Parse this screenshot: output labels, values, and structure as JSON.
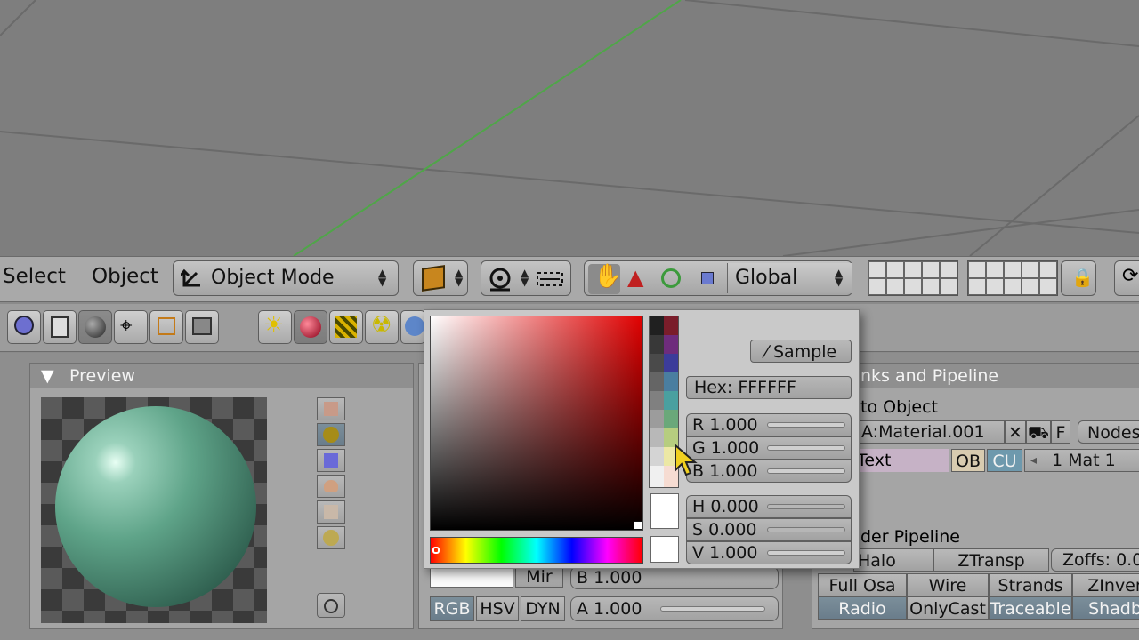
{
  "colors": {
    "viewport_bg": "#7e7e7e",
    "grid": "#6c6c6c",
    "axis_y": "#4fa648",
    "sphere": "#5fa489"
  },
  "header": {
    "menus": [
      "Select",
      "Object"
    ],
    "mode": "Object Mode",
    "orientation": "Global"
  },
  "panels": {
    "preview": {
      "title": "Preview"
    },
    "links": {
      "title": "nks and Pipeline",
      "link_to": "to Object",
      "material_name": "A:Material.001",
      "x_label": "✕",
      "f_label": "F",
      "nodes_label": "Nodes",
      "me_label": "Text",
      "ob_label": "OB",
      "cu_label": "CU",
      "mat_index": "1 Mat 1",
      "render_title": "der Pipeline",
      "row1": [
        "Halo",
        "ZTransp",
        "Zoffs: 0.0"
      ],
      "row2": [
        "Full Osa",
        "Wire",
        "Strands",
        "ZInver"
      ],
      "row3": [
        "Radio",
        "OnlyCast",
        "Traceable",
        "Shadb"
      ]
    },
    "material": {
      "mir_label": "Mir",
      "b_field": "B 1.000",
      "a_field": "A 1.000",
      "modes": [
        "RGB",
        "HSV",
        "DYN"
      ]
    }
  },
  "picker": {
    "sample_label": "Sample",
    "hex": "Hex: FFFFFF",
    "r": "R 1.000",
    "g": "G 1.000",
    "b": "B 1.000",
    "h": "H 0.000",
    "s": "S 0.000",
    "v": "V 1.000",
    "swatches_left": [
      "#202020",
      "#383838",
      "#4a4a4a",
      "#656565",
      "#808080",
      "#9c9c9c",
      "#b8b8b8",
      "#d4d4d4",
      "#f0f0f0"
    ],
    "swatches_right": [
      "#7a1d2a",
      "#6e2c7c",
      "#3c3c9a",
      "#4a7ea0",
      "#4aa0a0",
      "#6aa87a",
      "#b6cd7f",
      "#ece8a5",
      "#f6dcd2"
    ]
  }
}
